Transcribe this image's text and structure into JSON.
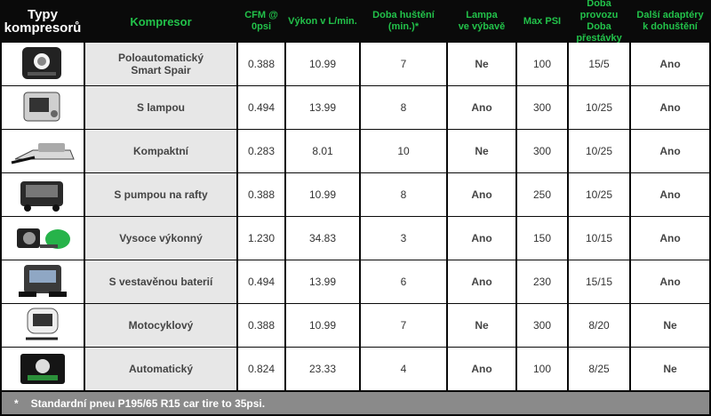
{
  "header": {
    "type": "Typy\nkompresorů",
    "compressor": "Kompresor",
    "cfm": "CFM @ 0psi",
    "flow": "Výkon v L/min.",
    "inflate_time": "Doba huštění\n(min.)*",
    "lamp": "Lampa\nve výbavě",
    "max_psi": "Max PSI",
    "duty": "Doba provozu\nDoba přestávky",
    "adapters": "Další adaptéry\nk dohuštění"
  },
  "rows": [
    {
      "icon": "compressor-smart-spair-icon",
      "name": "Poloautomatický\nSmart Spair",
      "cfm": "0.388",
      "flow": "10.99",
      "time": "7",
      "lamp": "Ne",
      "psi": "100",
      "duty": "15/5",
      "adapters": "Ano"
    },
    {
      "icon": "compressor-with-lamp-icon",
      "name": "S lampou",
      "cfm": "0.494",
      "flow": "13.99",
      "time": "8",
      "lamp": "Ano",
      "psi": "300",
      "duty": "10/25",
      "adapters": "Ano"
    },
    {
      "icon": "compact-compressor-icon",
      "name": "Kompaktní",
      "cfm": "0.283",
      "flow": "8.01",
      "time": "10",
      "lamp": "Ne",
      "psi": "300",
      "duty": "10/25",
      "adapters": "Ano"
    },
    {
      "icon": "raft-pump-compressor-icon",
      "name": "S pumpou na rafty",
      "cfm": "0.388",
      "flow": "10.99",
      "time": "8",
      "lamp": "Ano",
      "psi": "250",
      "duty": "10/25",
      "adapters": "Ano"
    },
    {
      "icon": "high-power-compressor-icon",
      "name": "Vysoce výkonný",
      "cfm": "1.230",
      "flow": "34.83",
      "time": "3",
      "lamp": "Ano",
      "psi": "150",
      "duty": "10/15",
      "adapters": "Ano"
    },
    {
      "icon": "battery-compressor-icon",
      "name": "S vestavěnou baterií",
      "cfm": "0.494",
      "flow": "13.99",
      "time": "6",
      "lamp": "Ano",
      "psi": "230",
      "duty": "15/15",
      "adapters": "Ano"
    },
    {
      "icon": "motorcycle-compressor-icon",
      "name": "Motocyklový",
      "cfm": "0.388",
      "flow": "10.99",
      "time": "7",
      "lamp": "Ne",
      "psi": "300",
      "duty": "8/20",
      "adapters": "Ne"
    },
    {
      "icon": "automatic-compressor-icon",
      "name": "Automatický",
      "cfm": "0.824",
      "flow": "23.33",
      "time": "4",
      "lamp": "Ano",
      "psi": "100",
      "duty": "8/25",
      "adapters": "Ne"
    }
  ],
  "footer": {
    "star": "*",
    "note": "Standardní pneu  P195/65 R15 car tire to 35psi."
  },
  "colors": {
    "header_bg": "#0a0a0a",
    "header_green": "#22c24a",
    "name_bg": "#e7e7e7",
    "footer_bg": "#8a8a8a"
  }
}
